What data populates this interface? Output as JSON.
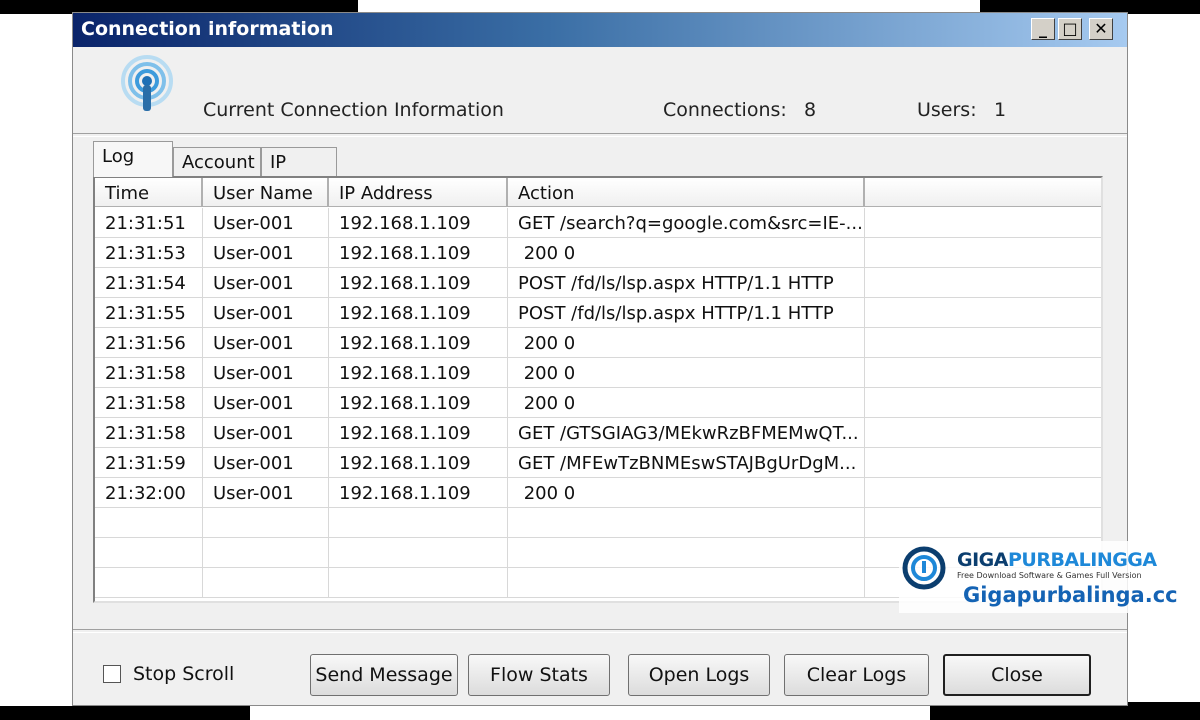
{
  "window": {
    "title": "Connection information",
    "minimize_glyph": "_",
    "maximize_glyph": "□",
    "close_glyph": "✕"
  },
  "header": {
    "icon": "wireless-signal-icon",
    "heading": "Current Connection Information",
    "connections_label": "Connections:",
    "connections_value": "8",
    "users_label": "Users:",
    "users_value": "1"
  },
  "tabs": [
    {
      "label": "Log",
      "active": true
    },
    {
      "label": "Account",
      "active": false
    },
    {
      "label": "IP",
      "active": false
    }
  ],
  "log_table": {
    "columns": [
      "Time",
      "User Name",
      "IP Address",
      "Action",
      ""
    ],
    "rows": [
      {
        "time": "21:31:51",
        "user": "User-001",
        "ip": "192.168.1.109",
        "action": "GET /search?q=google.com&src=IE-..."
      },
      {
        "time": "21:31:53",
        "user": "User-001",
        "ip": "192.168.1.109",
        "action": " 200 0"
      },
      {
        "time": "21:31:54",
        "user": "User-001",
        "ip": "192.168.1.109",
        "action": "POST /fd/ls/lsp.aspx HTTP/1.1 HTTP"
      },
      {
        "time": "21:31:55",
        "user": "User-001",
        "ip": "192.168.1.109",
        "action": "POST /fd/ls/lsp.aspx HTTP/1.1 HTTP"
      },
      {
        "time": "21:31:56",
        "user": "User-001",
        "ip": "192.168.1.109",
        "action": " 200 0"
      },
      {
        "time": "21:31:58",
        "user": "User-001",
        "ip": "192.168.1.109",
        "action": " 200 0"
      },
      {
        "time": "21:31:58",
        "user": "User-001",
        "ip": "192.168.1.109",
        "action": " 200 0"
      },
      {
        "time": "21:31:58",
        "user": "User-001",
        "ip": "192.168.1.109",
        "action": "GET /GTSGIAG3/MEkwRzBFMEMwQT..."
      },
      {
        "time": "21:31:59",
        "user": "User-001",
        "ip": "192.168.1.109",
        "action": "GET /MFEwTzBNMEswSTAJBgUrDgM..."
      },
      {
        "time": "21:32:00",
        "user": "User-001",
        "ip": "192.168.1.109",
        "action": " 200 0"
      }
    ]
  },
  "footer": {
    "stop_scroll_label": "Stop Scroll",
    "stop_scroll_checked": false,
    "buttons": {
      "send_message": "Send Message",
      "flow_stats": "Flow Stats",
      "open_logs": "Open Logs",
      "clear_logs": "Clear Logs",
      "close": "Close"
    }
  },
  "watermark": {
    "brand_part1": "GIGA",
    "brand_part2": "PURBALINGGA",
    "tagline": "Free Download Software & Games Full Version",
    "url": "Gigapurbalinga.cc"
  },
  "colors": {
    "title_gradient_start": "#0a246a",
    "title_gradient_end": "#a6caf0",
    "dialog_bg": "#f0f0f0",
    "watermark_blue": "#1463b4"
  }
}
